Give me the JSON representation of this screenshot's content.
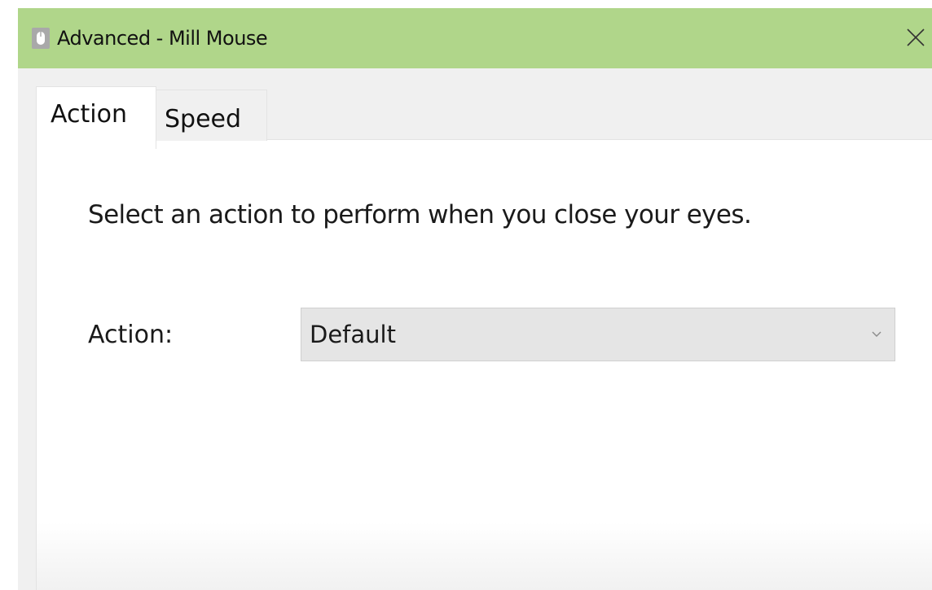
{
  "window": {
    "title": "Advanced - Mill Mouse",
    "titlebar_color": "#b0d68a",
    "app_icon": "mouse-icon",
    "close_icon": "close-icon"
  },
  "tabs": [
    {
      "label": "Action",
      "selected": true
    },
    {
      "label": "Speed",
      "selected": false
    }
  ],
  "action_tab": {
    "instruction": "Select an action to perform when you close your eyes.",
    "action_label": "Action:",
    "action_select": {
      "value": "Default",
      "icon": "chevron-down-icon"
    }
  }
}
